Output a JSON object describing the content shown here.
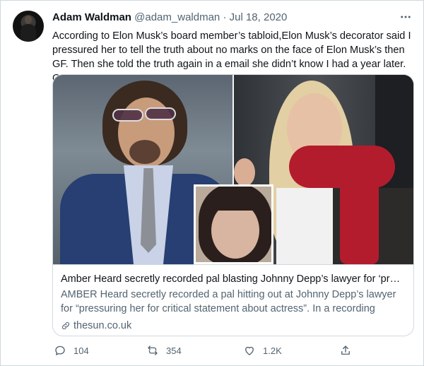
{
  "tweet": {
    "author_name": "Adam Waldman",
    "handle": "@adam_waldman",
    "separator": "·",
    "date": "Jul 18, 2020",
    "text": "According to Elon Musk’s board member’s tabloid,Elon Musk’s decorator said I pressured her to tell the truth about no marks on the face of Elon Musk’s then GF. Then she told the truth again in a email she didn’t know I had a year later. Oops!",
    "more_icon": "more-horizontal-icon"
  },
  "card": {
    "title": "Amber Heard secretly recorded pal blasting Johnny Depp’s lawyer for ‘pressu...",
    "description": "AMBER Heard secretly recorded a pal hitting out at Johnny Depp’s lawyer for “pressuring her for critical statement about actress”. In a recording played in ...",
    "domain": "thesun.co.uk"
  },
  "actions": {
    "replies": "104",
    "retweets": "354",
    "likes": "1.2K"
  },
  "colors": {
    "text_primary": "#0f1419",
    "text_secondary": "#536471",
    "border": "#cfd9de",
    "scarf_red": "#b31c2d"
  }
}
